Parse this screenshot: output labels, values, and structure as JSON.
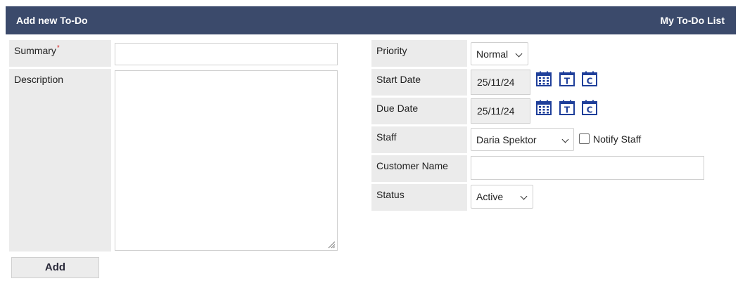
{
  "header": {
    "title": "Add new To-Do",
    "link": "My To-Do List"
  },
  "form": {
    "summary": {
      "label": "Summary",
      "required_mark": "*",
      "value": ""
    },
    "description": {
      "label": "Description",
      "value": ""
    },
    "priority": {
      "label": "Priority",
      "selected": "Normal"
    },
    "start_date": {
      "label": "Start Date",
      "value": "25/11/24"
    },
    "due_date": {
      "label": "Due Date",
      "value": "25/11/24"
    },
    "staff": {
      "label": "Staff",
      "selected": "Daria Spektor",
      "notify_label": "Notify Staff",
      "notify_checked": false
    },
    "customer_name": {
      "label": "Customer Name",
      "value": ""
    },
    "status": {
      "label": "Status",
      "selected": "Active"
    },
    "date_buttons": {
      "today_letter": "T",
      "clear_letter": "C"
    },
    "add_button": "Add"
  },
  "colors": {
    "header_bg": "#3b4a6b",
    "label_bg": "#ebebeb",
    "icon_blue": "#1f3f9a"
  }
}
